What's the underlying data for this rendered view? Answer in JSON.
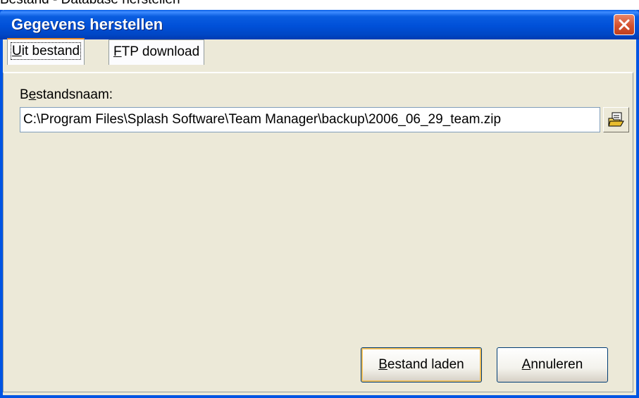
{
  "caption_above": "Bestand - Database herstellen",
  "window": {
    "title": "Gegevens herstellen"
  },
  "tabs": [
    {
      "label_accel": "U",
      "label_rest": "it bestand",
      "active": true
    },
    {
      "label_accel": "F",
      "label_rest": "TP download",
      "active": false
    }
  ],
  "form": {
    "label_accel": "e",
    "label_pre": "B",
    "label_post": "standsnaam:",
    "path_value": "C:\\Program Files\\Splash Software\\Team Manager\\backup\\2006_06_29_team.zip"
  },
  "buttons": {
    "load_accel": "B",
    "load_rest": "estand laden",
    "cancel_accel": "A",
    "cancel_rest": "nnuleren"
  },
  "colors": {
    "title_bar": "#0054e3",
    "close_button": "#d4512e",
    "dialog_bg": "#ece9d8",
    "active_tab_accent": "#e68b2c"
  }
}
